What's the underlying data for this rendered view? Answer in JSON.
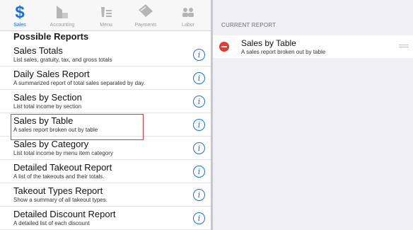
{
  "tabs": [
    {
      "label": "Sales",
      "icon": "dollar-icon",
      "active": true
    },
    {
      "label": "Accounting",
      "icon": "accounting-icon",
      "active": false
    },
    {
      "label": "Menu",
      "icon": "menu-icon",
      "active": false
    },
    {
      "label": "Payments",
      "icon": "payments-icon",
      "active": false
    },
    {
      "label": "Labor",
      "icon": "labor-icon",
      "active": false
    }
  ],
  "possible_reports": {
    "title": "Possible Reports",
    "items": [
      {
        "title": "Sales Totals",
        "subtitle": "List sales, gratuity, tax, and gross totals"
      },
      {
        "title": "Daily Sales Report",
        "subtitle": "A summarized report of total sales separated by day."
      },
      {
        "title": "Sales by Section",
        "subtitle": "List total income by section"
      },
      {
        "title": "Sales by Table",
        "subtitle": "A sales report broken out by table"
      },
      {
        "title": "Sales by Category",
        "subtitle": "List total income by menu item category"
      },
      {
        "title": "Detailed Takeout Report",
        "subtitle": "A list of the takeouts and their totals."
      },
      {
        "title": "Takeout Types Report",
        "subtitle": "Show a summary of all takeout types."
      },
      {
        "title": "Detailed Discount Report",
        "subtitle": "A detailed list of each discount"
      }
    ],
    "info_glyph": "i"
  },
  "current_report": {
    "header": "CURRENT REPORT",
    "items": [
      {
        "title": "Sales by Table",
        "subtitle": "A sales report broken out by table"
      }
    ]
  },
  "colors": {
    "accent": "#1a6fe0",
    "delete": "#e8392e",
    "highlight": "#e03a3a"
  }
}
